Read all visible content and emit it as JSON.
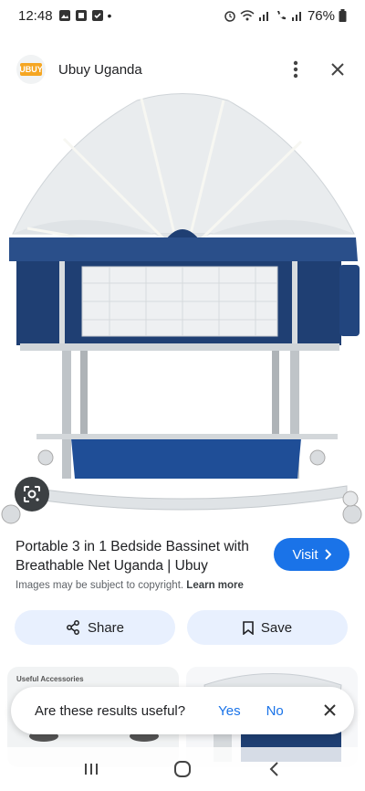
{
  "status_bar": {
    "time": "12:48",
    "battery": "76%"
  },
  "header": {
    "favicon_text": "UBUY",
    "site_name": "Ubuy Uganda"
  },
  "result": {
    "title": "Portable 3 in 1 Bedside Bassinet with Breathable Net Uganda | Ubuy",
    "visit_label": "Visit",
    "copyright_text": "Images may be subject to copyright.",
    "learn_more": "Learn more",
    "share_label": "Share",
    "save_label": "Save"
  },
  "related": {
    "first_label": "Useful Accessories"
  },
  "feedback": {
    "question": "Are these results useful?",
    "yes": "Yes",
    "no": "No"
  },
  "colors": {
    "accent": "#1a73e8",
    "chip_bg": "#e8f0fe",
    "bassinet_blue": "#1f3f73"
  }
}
